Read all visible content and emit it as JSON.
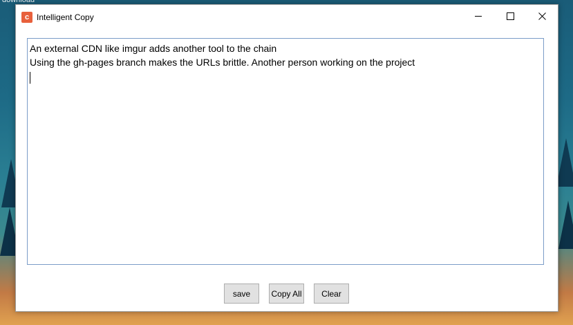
{
  "desktop": {
    "label": "download"
  },
  "window": {
    "title": "Intelligent Copy",
    "app_icon_glyph": "c",
    "controls": {
      "minimize": "minimize-icon",
      "maximize": "maximize-icon",
      "close": "close-icon"
    }
  },
  "editor": {
    "lines": [
      "An external CDN like imgur adds another tool to the chain",
      "Using the gh-pages branch makes the URLs brittle. Another person working on the project"
    ]
  },
  "buttons": {
    "save": "save",
    "copy_all": "Copy All",
    "clear": "Clear"
  },
  "colors": {
    "app_icon": "#e8603c",
    "editor_border": "#7a9cc7",
    "button_bg": "#e1e1e1"
  }
}
